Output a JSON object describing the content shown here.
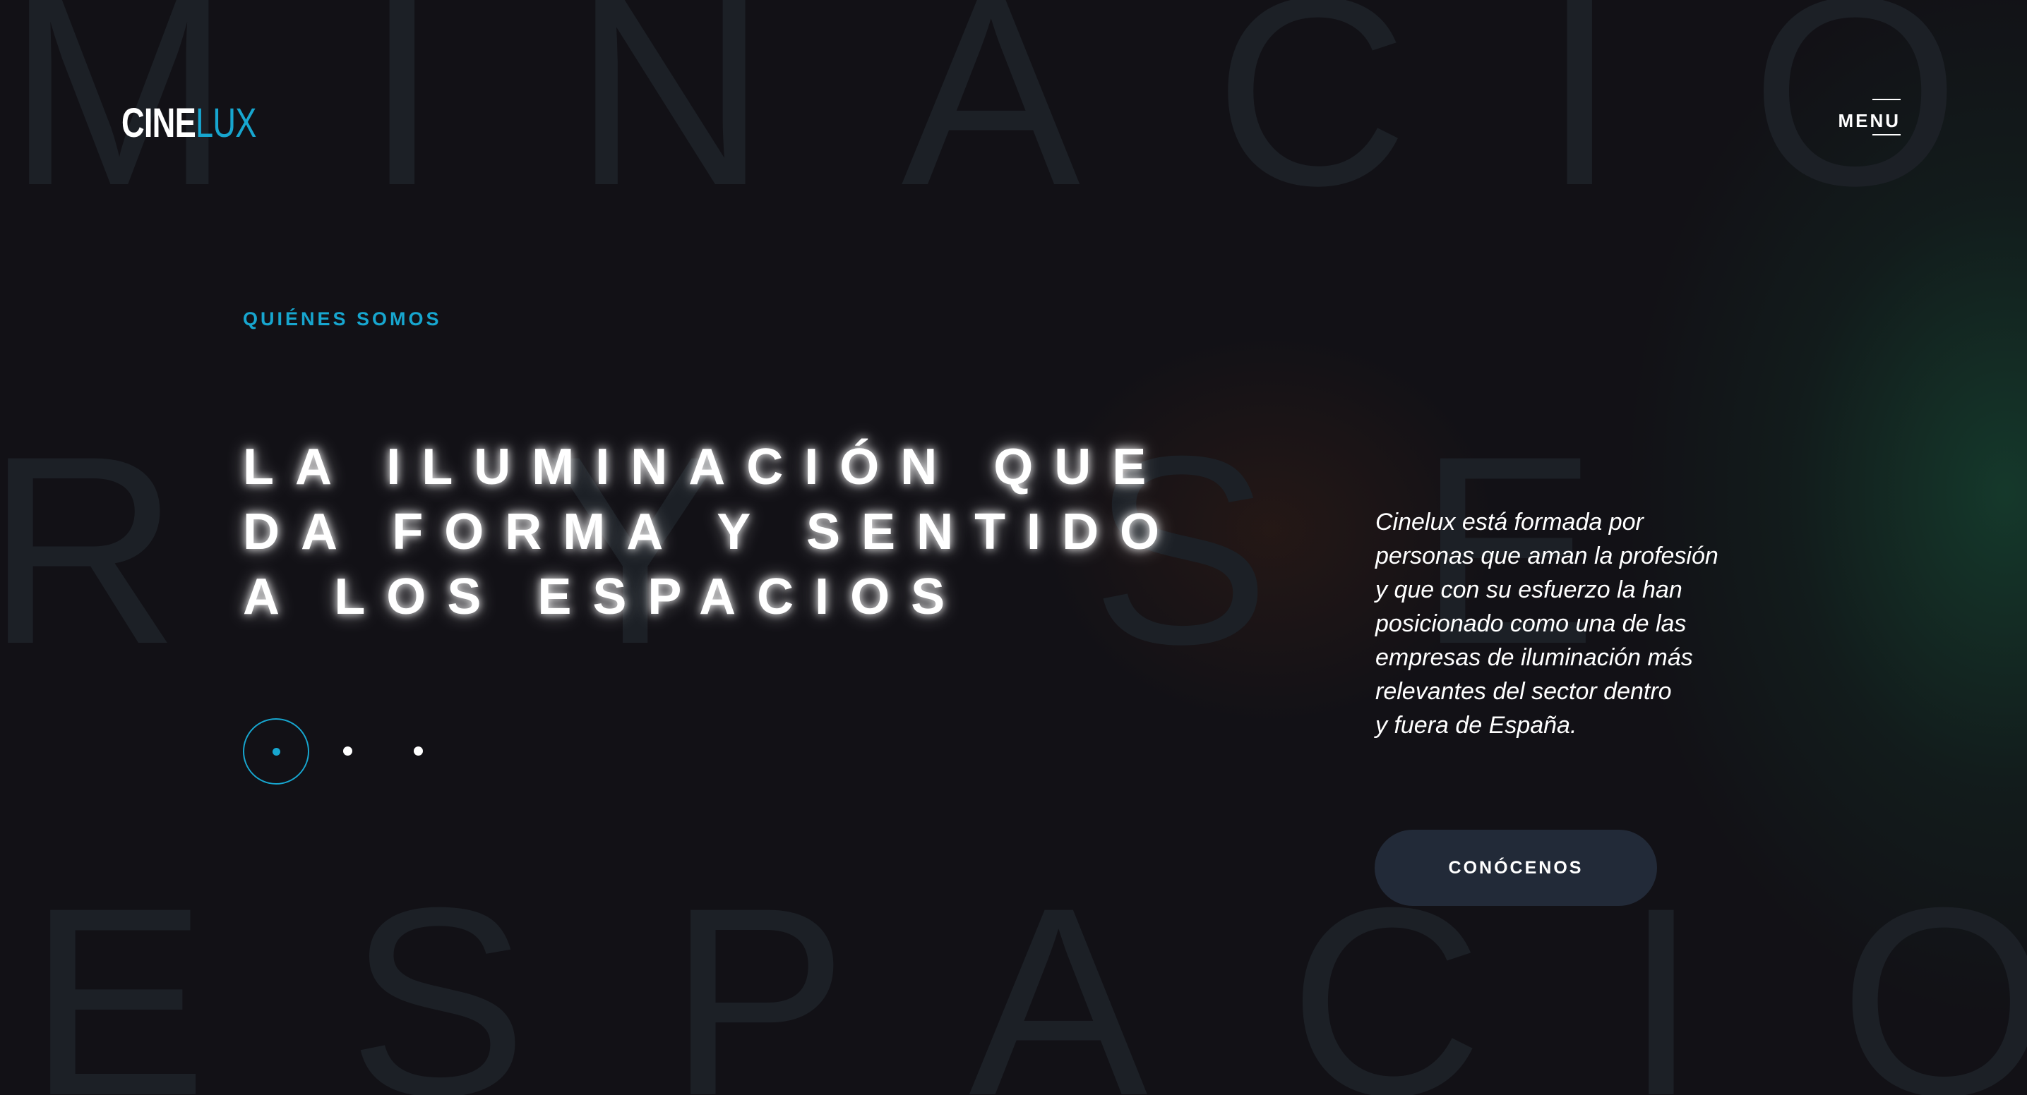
{
  "brand": {
    "part1": "CINE",
    "part2": "LUX"
  },
  "nav": {
    "menu_label": "MENU"
  },
  "background_words": {
    "top": "MINACIO",
    "middle": "R   Y   SE",
    "bottom": "ESPACIO"
  },
  "hero": {
    "kicker": "QUIÉNES SOMOS",
    "headline_lines": [
      "LA ILUMINACIÓN QUE",
      "DA FORMA Y SENTIDO",
      "A LOS ESPACIOS"
    ],
    "slider": {
      "slides": 3,
      "active": 1
    }
  },
  "about": {
    "lines": [
      "Cinelux está formada por",
      "personas que aman la profesión",
      "y que con su esfuerzo la han",
      "posicionado como una de las",
      "empresas de iluminación más",
      "relevantes del sector dentro",
      "y fuera de España."
    ],
    "cta_label": "CONÓCENOS"
  },
  "colors": {
    "accent": "#17a6cf",
    "background": "#121116",
    "button_bg": "#222a38",
    "text": "#ffffff"
  }
}
